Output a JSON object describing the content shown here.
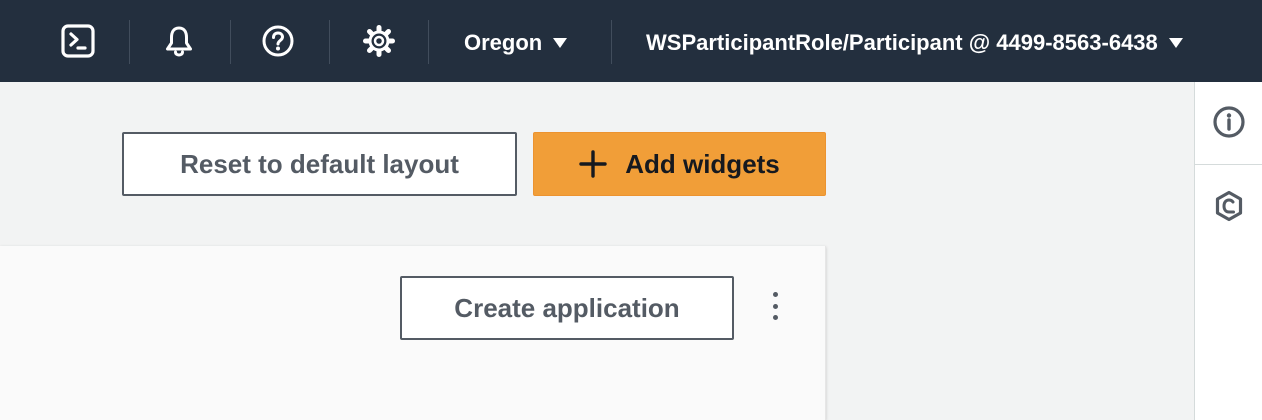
{
  "topbar": {
    "icons": [
      "cloudshell-icon",
      "bell-icon",
      "help-icon",
      "gear-icon"
    ],
    "region": {
      "label": "Oregon"
    },
    "account": {
      "label": "WSParticipantRole/Participant @ 4499-8563-6438"
    }
  },
  "header": {
    "reset_label": "Reset to default layout",
    "add_widgets_label": "Add widgets"
  },
  "card": {
    "create_application_label": "Create application"
  },
  "rightpanel": {
    "icons": [
      "info-icon",
      "feedback-icon"
    ]
  },
  "colors": {
    "nav_bg": "#232f3e",
    "primary": "#f19e38",
    "page_bg": "#f2f3f3",
    "text_dark": "#16191f",
    "text_gray": "#545b64"
  }
}
